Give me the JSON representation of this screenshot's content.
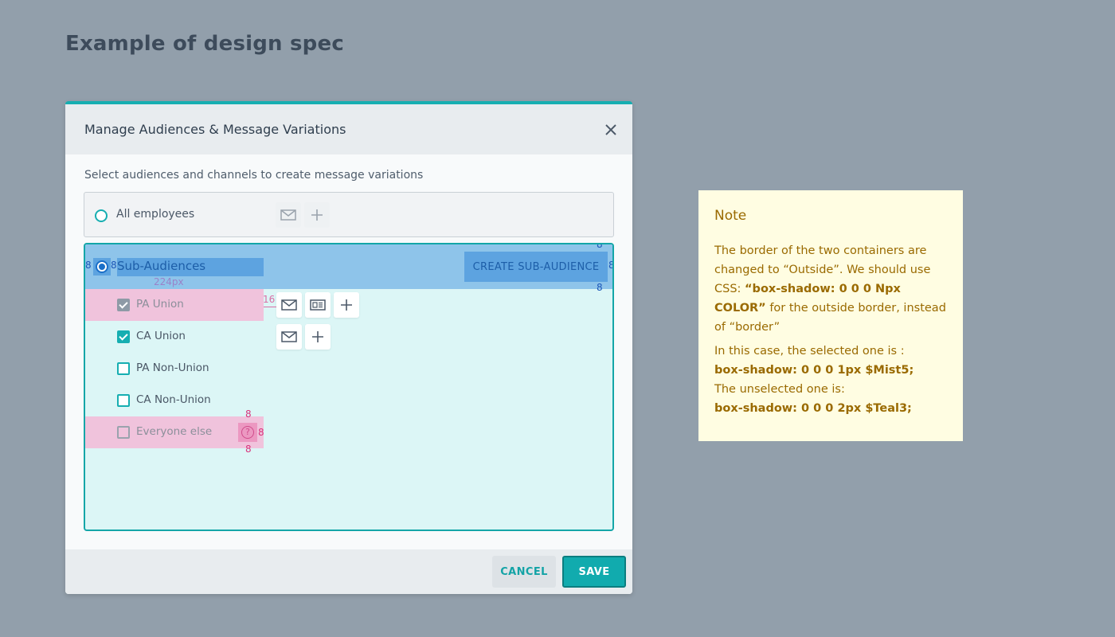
{
  "page": {
    "title": "Example of design spec"
  },
  "modal": {
    "title": "Manage Audiences & Message Variations",
    "close_label": "×",
    "subtitle": "Select audiences and channels to create message variations",
    "all_employees": {
      "label": "All employees",
      "selected": false
    },
    "sub_audiences": {
      "label": "Sub-Audiences",
      "selected": true,
      "create_button": "CREATE SUB-AUDIENCE",
      "rows": [
        {
          "label": "PA Union",
          "checked": true
        },
        {
          "label": "CA Union",
          "checked": true
        },
        {
          "label": "PA Non-Union",
          "checked": false
        },
        {
          "label": "CA Non-Union",
          "checked": false
        },
        {
          "label": "Everyone else",
          "checked": false,
          "help_icon": "question-circle-icon"
        }
      ]
    },
    "footer": {
      "cancel": "CANCEL",
      "save": "SAVE"
    }
  },
  "spec_annotations": {
    "pad_left_radio": "8",
    "pad_right_radio": "8",
    "pad_top_create": "8",
    "pad_right_create": "8",
    "pad_bottom_create": "8",
    "label_width": "224px",
    "icon_gap": "16",
    "help_top": "8",
    "help_right": "8",
    "help_bottom": "8"
  },
  "note": {
    "title": "Note",
    "p1_text": "The border of the two containers are changed to “Outside”.  We should use CSS: ",
    "p1_bold": "“box-shadow: 0 0 0 Npx COLOR”",
    "p1_tail": " for the outside border, instead of “border”",
    "p2_intro": "In this case, the selected one is :",
    "p2_selected_code": "box-shadow: 0 0 0 1px $Mist5;",
    "p2_unselected_intro": "The unselected one is:",
    "p2_unselected_code": "box-shadow: 0 0 0 2px $Teal3;"
  },
  "colors": {
    "background": "#929fab",
    "teal": "#16aeb1",
    "spec_blue": "#5da3e0",
    "spec_pink": "#f0c3dc",
    "note_bg": "#fffde2",
    "note_text": "#9a6a00"
  },
  "icons": [
    "close-icon",
    "mail-icon",
    "newsletter-icon",
    "plus-icon",
    "question-circle-icon"
  ]
}
